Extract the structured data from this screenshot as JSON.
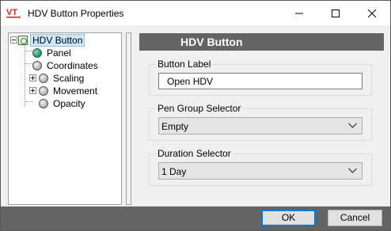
{
  "window": {
    "title": "HDV Button Properties",
    "app_icon": "vt-logo-icon",
    "controls": [
      "minimize-icon",
      "maximize-icon",
      "close-icon"
    ]
  },
  "tree": {
    "root": {
      "label": "HDV Button",
      "expanded": true,
      "selected": true
    },
    "items": [
      {
        "label": "Panel",
        "icon": "green-dot-icon",
        "expandable": false
      },
      {
        "label": "Coordinates",
        "icon": "gray-dot-icon",
        "expandable": false
      },
      {
        "label": "Scaling",
        "icon": "gray-dot-icon",
        "expandable": true
      },
      {
        "label": "Movement",
        "icon": "gray-dot-icon",
        "expandable": true
      },
      {
        "label": "Opacity",
        "icon": "gray-dot-icon",
        "expandable": false
      }
    ]
  },
  "panel": {
    "header": "HDV Button",
    "button_label": {
      "legend": "Button Label",
      "value": "Open HDV"
    },
    "pen_group": {
      "legend": "Pen Group Selector",
      "selected": "Empty"
    },
    "duration": {
      "legend": "Duration Selector",
      "selected": "1 Day"
    }
  },
  "footer": {
    "ok_label": "OK",
    "cancel_label": "Cancel"
  },
  "colors": {
    "header_bg": "#646464",
    "selection_bg": "#cce8ff",
    "focus_border": "#0078d7"
  }
}
